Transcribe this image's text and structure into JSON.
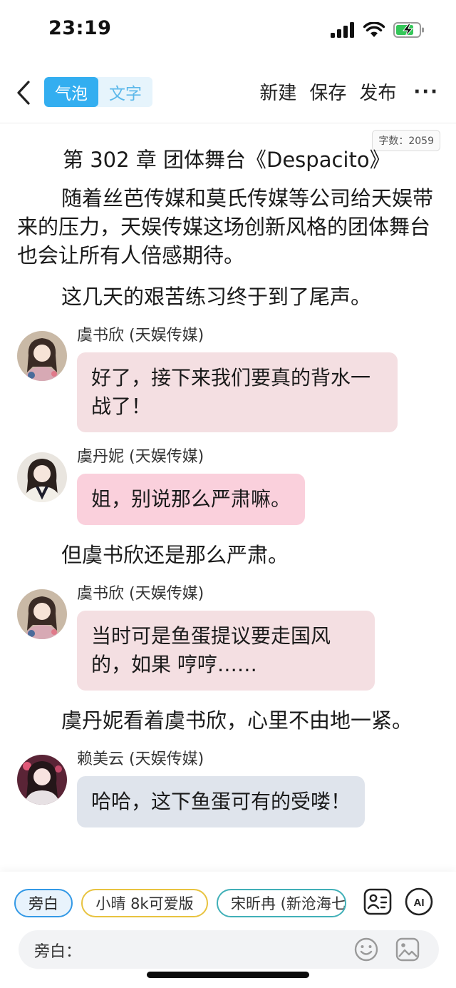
{
  "status": {
    "time": "23:19"
  },
  "toolbar": {
    "mode_bubble": "气泡",
    "mode_text": "文字",
    "new_label": "新建",
    "save_label": "保存",
    "publish_label": "发布",
    "more_label": "···"
  },
  "word_count": "字数：2059",
  "chapter": {
    "title": "第 302 章  团体舞台《Despacito》",
    "para1": "随着丝芭传媒和莫氏传媒等公司给天娱带来的压力，天娱传媒这场创新风格的团体舞台也会让所有人倍感期待。",
    "para2": "这几天的艰苦练习终于到了尾声。",
    "para3": "但虞书欣还是那么严肃。",
    "para4": "虞丹妮看着虞书欣，心里不由地一紧。"
  },
  "messages": [
    {
      "speaker": "虞书欣 (天娱传媒)",
      "text": "好了，接下来我们要真的背水一战了！"
    },
    {
      "speaker": "虞丹妮 (天娱传媒)",
      "text": "姐，别说那么严肃嘛。"
    },
    {
      "speaker": "虞书欣 (天娱传媒)",
      "text": "当时可是鱼蛋提议要走国风的，如果 哼哼……"
    },
    {
      "speaker": "赖美云 (天娱传媒)",
      "text": "哈哈，这下鱼蛋可有的受喽！"
    }
  ],
  "roles": [
    "旁白",
    "小晴 8k可爱版",
    "宋昕冉 (新沧海七"
  ],
  "input": {
    "label": "旁白：",
    "value": ""
  },
  "colors": {
    "accent": "#33aef0",
    "chip_blue": "#3399e6",
    "chip_yellow": "#e8c340",
    "chip_teal": "#41b0b8"
  }
}
